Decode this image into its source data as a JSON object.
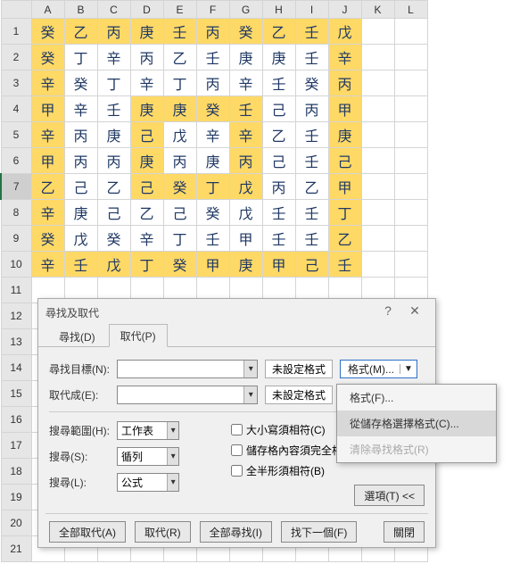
{
  "columns": [
    "A",
    "B",
    "C",
    "D",
    "E",
    "F",
    "G",
    "H",
    "I",
    "J",
    "K",
    "L"
  ],
  "row_count": 21,
  "selected_row": 7,
  "grid": [
    [
      "癸",
      "乙",
      "丙",
      "庚",
      "壬",
      "丙",
      "癸",
      "乙",
      "壬",
      "戊"
    ],
    [
      "癸",
      "丁",
      "辛",
      "丙",
      "乙",
      "壬",
      "庚",
      "庚",
      "壬",
      "辛"
    ],
    [
      "辛",
      "癸",
      "丁",
      "辛",
      "丁",
      "丙",
      "辛",
      "壬",
      "癸",
      "丙"
    ],
    [
      "甲",
      "辛",
      "壬",
      "庚",
      "庚",
      "癸",
      "壬",
      "己",
      "丙",
      "甲"
    ],
    [
      "辛",
      "丙",
      "庚",
      "己",
      "戊",
      "辛",
      "辛",
      "乙",
      "壬",
      "庚"
    ],
    [
      "甲",
      "丙",
      "丙",
      "庚",
      "丙",
      "庚",
      "丙",
      "己",
      "壬",
      "己"
    ],
    [
      "乙",
      "己",
      "乙",
      "己",
      "癸",
      "丁",
      "戊",
      "丙",
      "乙",
      "甲"
    ],
    [
      "辛",
      "庚",
      "己",
      "乙",
      "己",
      "癸",
      "戊",
      "壬",
      "壬",
      "丁"
    ],
    [
      "癸",
      "戊",
      "癸",
      "辛",
      "丁",
      "壬",
      "甲",
      "壬",
      "壬",
      "乙"
    ],
    [
      "辛",
      "壬",
      "戊",
      "丁",
      "癸",
      "甲",
      "庚",
      "甲",
      "己",
      "壬"
    ]
  ],
  "dialog": {
    "title": "尋找及取代",
    "tabs": {
      "find": "尋找(D)",
      "replace": "取代(P)"
    },
    "find_label": "尋找目標(N):",
    "replace_label": "取代成(E):",
    "no_format": "未設定格式",
    "format_button": "格式(M)...",
    "scope_label": "搜尋範圍(H):",
    "scope_value": "工作表",
    "search_label": "搜尋(S):",
    "search_value": "循列",
    "lookin_label": "搜尋(L):",
    "lookin_value": "公式",
    "cb_case": "大小寫須相符(C)",
    "cb_whole": "儲存格內容須完全相符(O)",
    "cb_width": "全半形須相符(B)",
    "options_btn": "選項(T) <<",
    "btn_replace_all": "全部取代(A)",
    "btn_replace": "取代(R)",
    "btn_find_all": "全部尋找(I)",
    "btn_find_next": "找下一個(F)",
    "btn_close": "關閉"
  },
  "menu": {
    "item_format": "格式(F)...",
    "item_choose": "從儲存格選擇格式(C)...",
    "item_clear": "清除尋找格式(R)"
  },
  "chart_data": {
    "type": "table"
  }
}
